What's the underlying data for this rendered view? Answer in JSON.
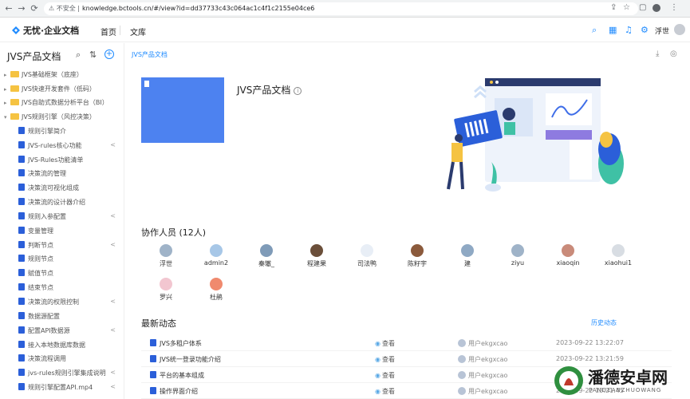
{
  "browser": {
    "security": "不安全",
    "url": "knowledge.bctools.cn/#/view?id=dd37733c43c064ac1c4f1c2155e04ce6"
  },
  "header": {
    "logo": "无忧·企业文档",
    "nav": [
      "首页",
      "文库"
    ],
    "user": "浮世"
  },
  "sidebar": {
    "title": "JVS产品文档",
    "folders": [
      {
        "label": "JVS基础框架（底座）",
        "expanded": false
      },
      {
        "label": "JVS快速开发套件（低码）",
        "expanded": false
      },
      {
        "label": "JVS自助式数据分析平台（BI）",
        "expanded": false
      },
      {
        "label": "JVS规则引擎（风控决策）",
        "expanded": true
      }
    ],
    "docs": [
      {
        "label": "规则引擎简介",
        "share": false
      },
      {
        "label": "JVS-rules核心功能",
        "share": true
      },
      {
        "label": "JVS-Rules功能清单",
        "share": false
      },
      {
        "label": "决策流的管理",
        "share": false
      },
      {
        "label": "决策流可视化组成",
        "share": false
      },
      {
        "label": "决策流的设计器介绍",
        "share": false
      },
      {
        "label": "规则入参配置",
        "share": true
      },
      {
        "label": "变量管理",
        "share": false
      },
      {
        "label": "判断节点",
        "share": true
      },
      {
        "label": "规则节点",
        "share": false
      },
      {
        "label": "赋值节点",
        "share": false
      },
      {
        "label": "结束节点",
        "share": false
      },
      {
        "label": "决策流的权限控制",
        "share": true
      },
      {
        "label": "数据源配置",
        "share": false
      },
      {
        "label": "配置API数据源",
        "share": true
      },
      {
        "label": "接入本地数据库数据",
        "share": false
      },
      {
        "label": "决策流程调用",
        "share": false
      },
      {
        "label": "jvs-rules规则引擎集成说明",
        "share": true
      },
      {
        "label": "规则引擎配置API.mp4",
        "share": true
      }
    ]
  },
  "main": {
    "breadcrumb": "JVS产品文档",
    "doc_title": "JVS产品文档",
    "collab_title": "协作人员 (12人)",
    "collaborators": [
      {
        "name": "浮世",
        "color": "#9fb3c8"
      },
      {
        "name": "admin2",
        "color": "#a7c7e7"
      },
      {
        "name": "秦辙_",
        "color": "#7f9bb8"
      },
      {
        "name": "程建果",
        "color": "#6b4f3a"
      },
      {
        "name": "司法鸭",
        "color": "#e8eef6"
      },
      {
        "name": "陈籽宇",
        "color": "#8b5a3c"
      },
      {
        "name": "建",
        "color": "#8fa9c4"
      },
      {
        "name": "ziyu",
        "color": "#9fb3c8"
      },
      {
        "name": "xiaoqin",
        "color": "#c98b7a"
      },
      {
        "name": "xiaohui1",
        "color": "#d8dde3"
      },
      {
        "name": "罗兴",
        "color": "#f2c6d0"
      },
      {
        "name": "杜鹃",
        "color": "#f08a6e"
      }
    ],
    "recent_title": "最新动态",
    "history_link": "历史动态",
    "recent": [
      {
        "doc": "JVS多租户体系",
        "action": "查看",
        "user": "用户ekgxcao",
        "time": "2023-09-22 13:22:07"
      },
      {
        "doc": "JVS统一登录功能介绍",
        "action": "查看",
        "user": "用户ekgxcao",
        "time": "2023-09-22 13:21:59"
      },
      {
        "doc": "平台的基本组成",
        "action": "查看",
        "user": "用户ekgxcao",
        "time": ""
      },
      {
        "doc": "操作界面介绍",
        "action": "查看",
        "user": "用户ekgxcao",
        "time": "2023-09-22 13:21:45"
      }
    ]
  },
  "watermark": {
    "main": "潘德安卓网",
    "sub": "PANDEANZHUOWANG"
  },
  "colors": {
    "accent": "#1f8bff",
    "cover": "#4d82f0",
    "folder": "#f5c342"
  }
}
